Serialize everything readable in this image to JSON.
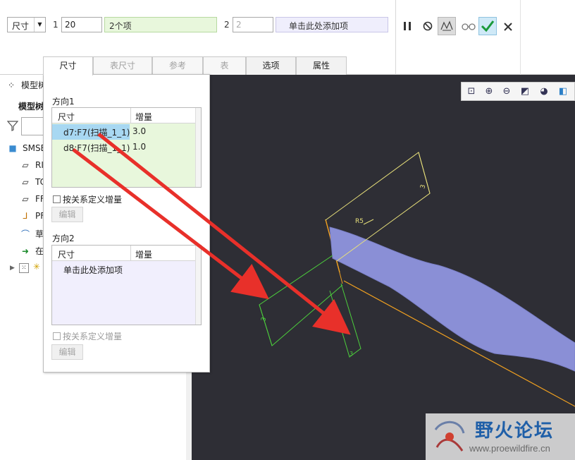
{
  "dashboard": {
    "type_value": "尺寸",
    "dir1_num": "1",
    "dir1_count": "20",
    "dir1_collector": "2个项",
    "dir2_num": "2",
    "dir2_count_placeholder": "2",
    "dir2_collector": "单击此处添加项",
    "tools": {
      "pause": "pause-icon",
      "no_preview": "no-preview-icon",
      "preview": "preview-icon",
      "glasses": "glasses-icon",
      "ok": "ok-icon",
      "cancel": "cancel-icon"
    }
  },
  "tabs": [
    {
      "label": "尺寸",
      "state": "active"
    },
    {
      "label": "表尺寸",
      "state": "disabled"
    },
    {
      "label": "参考",
      "state": "disabled"
    },
    {
      "label": "表",
      "state": "disabled"
    },
    {
      "label": "选项",
      "state": "normal"
    },
    {
      "label": "属性",
      "state": "normal"
    }
  ],
  "model_tree": {
    "title": "模型树",
    "subtitle": "模型树",
    "items": [
      {
        "label": "SMSE",
        "icon": "part-icon"
      },
      {
        "label": "RI",
        "icon": "datum-plane-icon"
      },
      {
        "label": "TC",
        "icon": "datum-plane-icon"
      },
      {
        "label": "FF",
        "icon": "datum-plane-icon"
      },
      {
        "label": "PF",
        "icon": "csys-icon"
      },
      {
        "label": "草",
        "icon": "sketch-icon"
      },
      {
        "label": "在",
        "icon": "insert-here-icon"
      },
      {
        "label": "",
        "icon": "pattern-icon"
      }
    ]
  },
  "panel": {
    "dir1": {
      "title": "方向1",
      "col_dim": "尺寸",
      "col_inc": "增量",
      "rows": [
        {
          "dim": "d7:F7(扫描_1_1)",
          "inc": "3.0"
        },
        {
          "dim": "d8:F7(扫描_1_1)",
          "inc": "1.0"
        }
      ],
      "checkbox": "按关系定义增量",
      "edit": "编辑"
    },
    "dir2": {
      "title": "方向2",
      "col_dim": "尺寸",
      "col_inc": "增量",
      "placeholder_row": "单击此处添加项",
      "checkbox": "按关系定义增量",
      "edit": "编辑"
    }
  },
  "graphics": {
    "background": "#2e2e35",
    "dim_labels": {
      "d7": "3",
      "d8": "3",
      "radius": "R5",
      "d7_green": "3"
    },
    "colors": {
      "sweep": "#8a8fd6",
      "yellow": "#e8e07a",
      "green": "#4ccd3c",
      "orange": "#f0a020",
      "arrow": "#e8302a"
    }
  },
  "view_toolbar": [
    "refit-icon",
    "zoom-in-icon",
    "zoom-out-icon",
    "repaint-icon",
    "shading-icon",
    "saved-views-icon"
  ],
  "watermark": {
    "title": "野火论坛",
    "url": "www.proewildfire.cn"
  }
}
